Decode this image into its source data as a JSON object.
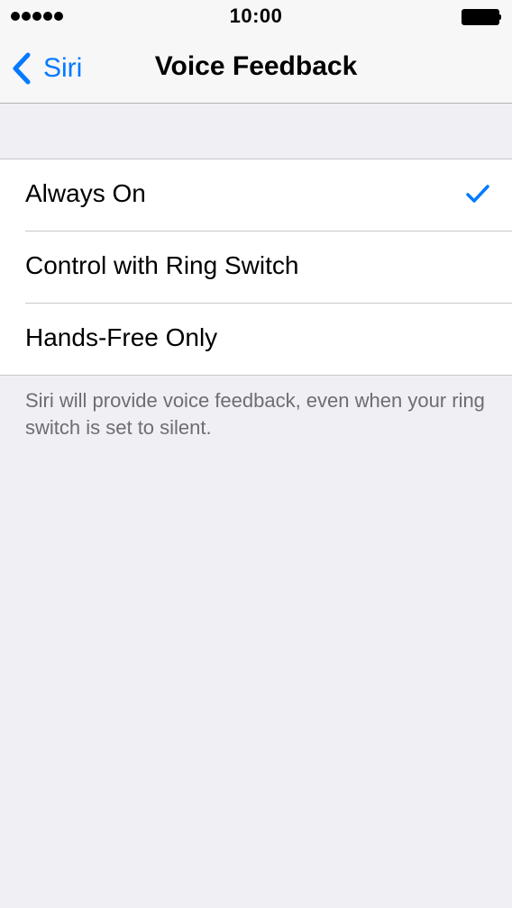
{
  "status_bar": {
    "time": "10:00",
    "signal_icon": "signal-dots-icon",
    "battery_icon": "battery-full-icon"
  },
  "nav": {
    "back_label": "Siri",
    "back_icon": "chevron-left-icon",
    "title": "Voice Feedback",
    "accent_color": "#007aff"
  },
  "options": {
    "items": [
      {
        "label": "Always On",
        "selected": true
      },
      {
        "label": "Control with Ring Switch",
        "selected": false
      },
      {
        "label": "Hands-Free Only",
        "selected": false
      }
    ],
    "check_icon": "checkmark-icon"
  },
  "footer": {
    "note": "Siri will provide voice feedback, even when your ring switch is set to silent."
  }
}
